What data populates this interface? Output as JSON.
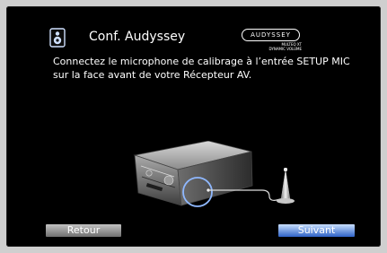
{
  "screen": {
    "title": "Conf. Audyssey",
    "logo": {
      "brand": "AUDYSSEY",
      "line1": "MULTEQ XT",
      "line2": "DYNAMIC VOLUME"
    },
    "instruction": "Connectez le microphone de calibrage à l’entrée SETUP MIC sur la face avant de votre Récepteur AV.",
    "buttons": {
      "back": "Retour",
      "next": "Suivant"
    }
  },
  "icons": [
    "speaker-icon",
    "av-receiver-illustration",
    "microphone-icon"
  ],
  "colors": {
    "background": "#000000",
    "text": "#ffffff",
    "next_button": "#2e63c7",
    "back_button": "#8a8a8a",
    "highlight": "#8fb8ff"
  }
}
